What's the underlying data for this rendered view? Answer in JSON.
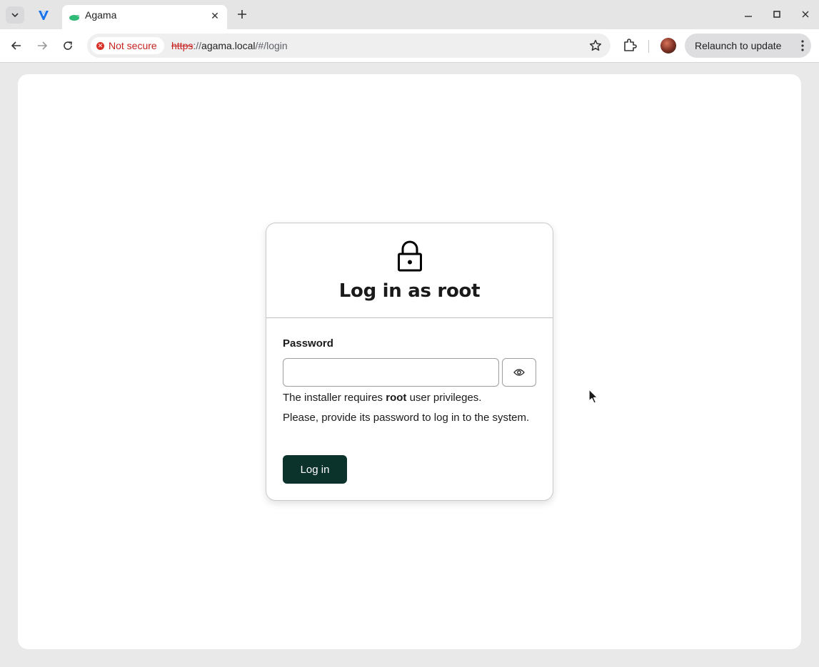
{
  "browser": {
    "tab": {
      "title": "Agama"
    },
    "address_bar": {
      "security_label": "Not secure",
      "url_scheme": "https",
      "url_separator": "://",
      "url_host": "agama.local",
      "url_path": "/#/login"
    },
    "relaunch_label": "Relaunch to update",
    "icons": [
      "tab-search-icon",
      "pinned-app-icon",
      "agama-favicon",
      "tab-close-icon",
      "new-tab-icon",
      "minimize-icon",
      "maximize-icon",
      "window-close-icon",
      "back-icon",
      "forward-icon",
      "reload-icon",
      "bookmark-star-icon",
      "extensions-icon",
      "profile-avatar",
      "more-vert-icon"
    ]
  },
  "login": {
    "title": "Log in as root",
    "password_label": "Password",
    "password_value": "",
    "help_prefix": "The installer requires ",
    "help_strong": "root",
    "help_suffix": " user privileges.",
    "help_line2": "Please, provide its password to log in to the system.",
    "submit_label": "Log in",
    "icons": [
      "lock-icon",
      "show-password-icon"
    ]
  },
  "colors": {
    "accent": "#0c322c",
    "danger": "#c5221f",
    "page_bg": "#ffffff",
    "chrome_bg": "#e5e5e6"
  }
}
